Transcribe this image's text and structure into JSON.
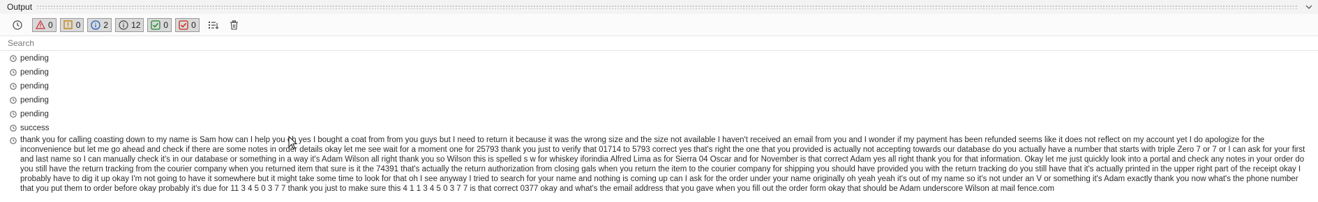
{
  "panel": {
    "title": "Output"
  },
  "toolbar": {
    "filters": [
      {
        "icon": "warning-triangle-icon",
        "count": "0",
        "color": "#d13438"
      },
      {
        "icon": "exclamation-box-icon",
        "count": "0",
        "color": "#c47b00"
      },
      {
        "icon": "info-circle-icon",
        "count": "2",
        "color": "#1f5fbf"
      },
      {
        "icon": "info-outline-icon",
        "count": "12",
        "color": "#444444"
      },
      {
        "icon": "check-green-icon",
        "count": "0",
        "color": "#1e8a2e"
      },
      {
        "icon": "check-red-icon",
        "count": "0",
        "color": "#c42b1c"
      }
    ]
  },
  "search": {
    "placeholder": "Search"
  },
  "log": {
    "entries": [
      {
        "text": "pending"
      },
      {
        "text": "pending"
      },
      {
        "text": "pending"
      },
      {
        "text": "pending"
      },
      {
        "text": "pending"
      },
      {
        "text": "success"
      },
      {
        "text": "thank you for calling coasting down to my name is Sam how can I help you  oh yes I bought a coat from from you guys but I need to return it because it was the wrong size and the size not available  I haven't received an email from you and I wonder if my payment has been refunded  seems like it does not reflect on my account yet I do apologize for the inconvenience but let me go ahead and check if there are some notes in order details okay let me see wait for a moment one for 25793 thank you just to verify that 01714 to 5793 correct yes that's right the one that you provided is actually not accepting towards our database do you actually have a number that starts with triple Zero 7 or 7  or I can ask for your first and last name so I can manually check it's in our database or something  in a way it's Adam Wilson all right thank you so Wilson this is spelled s w for whiskey iforindia Alfred Lima as for Sierra 04 Oscar and for November is that correct Adam yes all right thank you for that information. Okay let me just quickly look into a portal and check any notes in your order do you still have the return tracking from the courier company when you returned item  that sure is it the 74391 that's actually the return authorization from closing gals when you return the item to the courier company for shipping you should have provided you with the return tracking do you still have that it's actually printed in the upper right part of the receipt  okay I probably have to dig it up  okay I'm not going to have it somewhere but  it might take some time to look for that  oh I see anyway I tried to search for your name and nothing is coming up can I ask for the order under your name originally  oh yeah yeah it's out of my name so it's not under an V or something it's Adam exactly thank you now what's the phone number that you put them to order before okay probably it's due for 11 3 4 5 0 3 7 7 thank you just to make sure this 4 1 1 3 4 5 0 3 7 7 is that correct 0377 okay and what's the email address that you gave when you fill out the order form okay that should be Adam underscore Wilson at mail fence.com"
      }
    ]
  },
  "colors": {
    "accent_border": "#9a9a9a",
    "filter_bg": "#d9d9d9",
    "text": "#2b2b2b"
  }
}
